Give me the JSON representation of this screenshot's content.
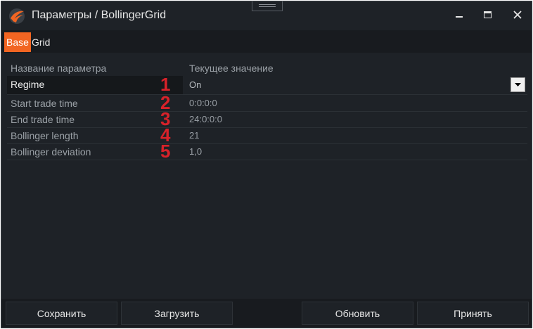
{
  "window": {
    "title": "Параметры / BollingerGrid",
    "icons": {
      "logo": "app-logo-icon",
      "minimize": "minimize-icon",
      "maximize": "maximize-icon",
      "close": "close-icon"
    }
  },
  "tabs": [
    {
      "label": "Base",
      "active": true
    },
    {
      "label": "Grid",
      "active": false
    }
  ],
  "table": {
    "headers": {
      "name": "Название параметра",
      "value": "Текущее значение"
    },
    "rows": [
      {
        "name": "Regime",
        "value": "On",
        "marker": "1"
      },
      {
        "name": "Start trade time",
        "value": "0:0:0:0",
        "marker": "2"
      },
      {
        "name": "End trade time",
        "value": "24:0:0:0",
        "marker": "3"
      },
      {
        "name": "Bollinger length",
        "value": "21",
        "marker": "4"
      },
      {
        "name": "Bollinger deviation",
        "value": "1,0",
        "marker": "5"
      }
    ]
  },
  "footer": {
    "save": "Сохранить",
    "load": "Загрузить",
    "refresh": "Обновить",
    "accept": "Принять"
  },
  "colors": {
    "background": "#1e2227",
    "accent": "#f26522",
    "marker": "#d8222a",
    "text": "#e6e6e6",
    "muted_text": "#9aa0a6"
  }
}
